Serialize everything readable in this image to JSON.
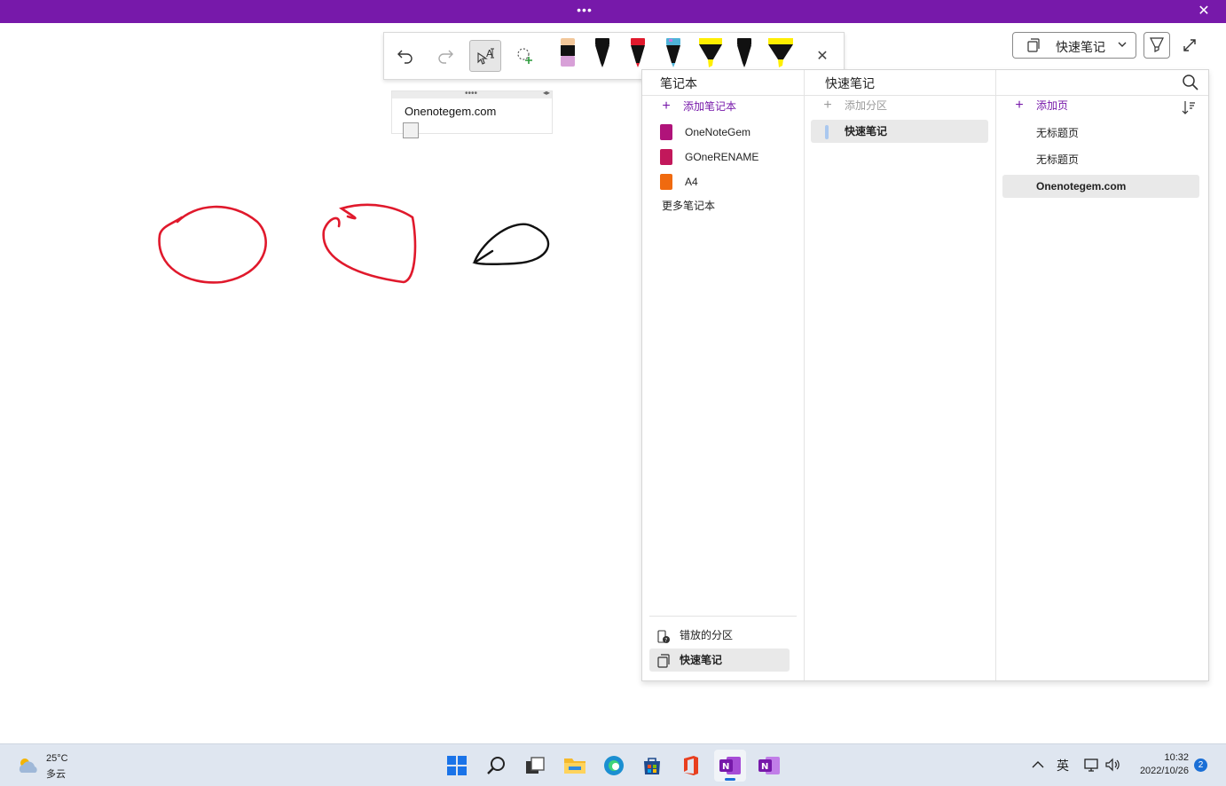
{
  "window": {
    "more_glyph": "•••",
    "close_glyph": "✕"
  },
  "toolbar": {
    "buttons": [
      "undo-icon",
      "redo-icon",
      "ink-to-text-icon",
      "lasso-add-icon"
    ],
    "pens": [
      {
        "kind": "eraser",
        "color": "#d8a0d8",
        "tip": "#f2c79a"
      },
      {
        "kind": "pen",
        "color": "#111111"
      },
      {
        "kind": "pen",
        "color": "#e0192c"
      },
      {
        "kind": "pen",
        "color": "#4fb3d8"
      },
      {
        "kind": "highlighter",
        "color": "#ffee00"
      },
      {
        "kind": "pen",
        "color": "#111111"
      },
      {
        "kind": "highlighter",
        "color": "#ffee00"
      }
    ],
    "close_glyph": "✕"
  },
  "note": {
    "text": "Onenotegem.com",
    "grip": "••••",
    "arrows": "◂▸"
  },
  "ink": {
    "colors": {
      "red": "#e0192c",
      "black": "#111111"
    }
  },
  "header": {
    "section_label": "快速笔记"
  },
  "nav": {
    "notebooks_header": "笔记本",
    "sections_header": "快速笔记",
    "add_notebook": "添加笔记本",
    "notebooks": [
      {
        "name": "OneNoteGem",
        "color": "#b0137a"
      },
      {
        "name": "GOneRENAME",
        "color": "#c2185b"
      },
      {
        "name": "A4",
        "color": "#f06a0f"
      }
    ],
    "more_notebooks": "更多笔记本",
    "misplaced_sections": "错放的分区",
    "quick_notes": "快速笔记",
    "add_section": "添加分区",
    "sections": [
      {
        "name": "快速笔记",
        "color": "#aac8ef"
      }
    ],
    "add_page": "添加页",
    "pages": [
      "无标题页",
      "无标题页",
      "Onenotegem.com"
    ]
  },
  "taskbar": {
    "weather_temp": "25°C",
    "weather_cond": "多云",
    "ime": "英",
    "time": "10:32",
    "date": "2022/10/26",
    "notifications": "2",
    "apps": [
      "windows-start-icon",
      "search-icon",
      "task-view-icon",
      "file-explorer-icon",
      "edge-icon",
      "store-icon",
      "office-icon",
      "onenote-icon",
      "onenote-2016-icon"
    ]
  }
}
